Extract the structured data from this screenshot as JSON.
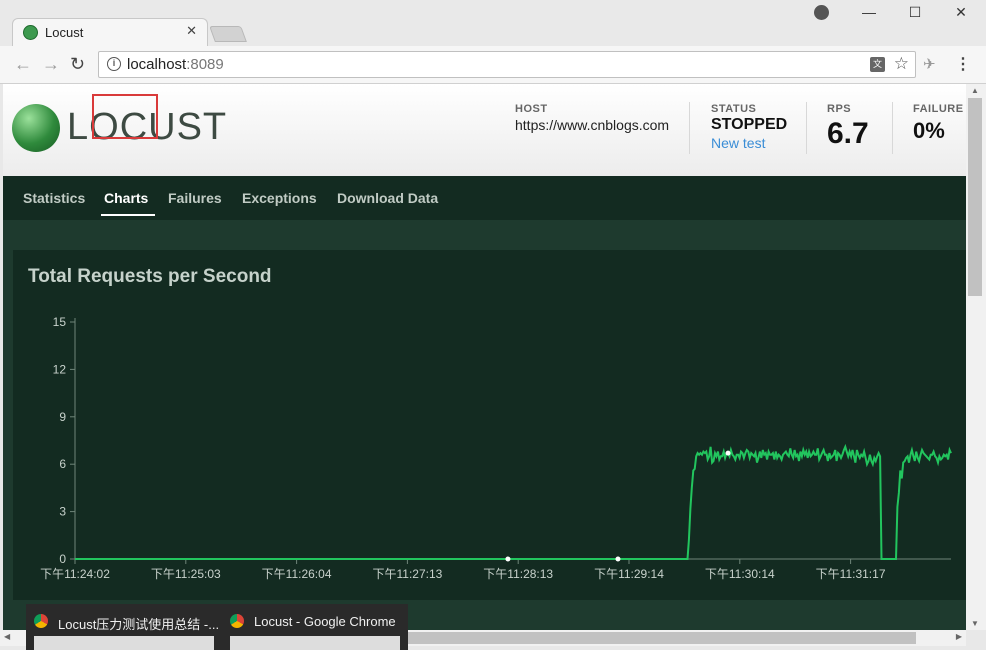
{
  "browser": {
    "tab_title": "Locust",
    "tab_close": "✕",
    "url_host": "localhost",
    "url_port": ":8089",
    "window_controls": [
      "—",
      "☐",
      "✕"
    ]
  },
  "header": {
    "logo_text": "LOCUST",
    "host_label": "HOST",
    "host_value": "https://www.cnblogs.com",
    "status_label": "STATUS",
    "status_value": "STOPPED",
    "new_test_link": "New test",
    "rps_label": "RPS",
    "rps_value": "6.7",
    "failure_label": "FAILURE",
    "failure_value": "0%"
  },
  "nav": {
    "items": [
      "Statistics",
      "Charts",
      "Failures",
      "Exceptions",
      "Download Data"
    ],
    "active": "Charts"
  },
  "panel": {
    "title": "Total Requests per Second"
  },
  "chart_data": {
    "type": "line",
    "title": "Total Requests per Second",
    "xlabel": "",
    "ylabel": "",
    "ylim": [
      0,
      15
    ],
    "y_ticks": [
      0,
      3,
      6,
      9,
      12,
      15
    ],
    "x_tick_labels": [
      "下午11:24:02",
      "下午11:25:03",
      "下午11:26:04",
      "下午11:27:13",
      "下午11:28:13",
      "下午11:29:14",
      "下午11:30:14",
      "下午11:31:17"
    ],
    "line_color": "#22c55e",
    "series": [
      {
        "values": [
          0,
          0,
          0,
          0,
          0,
          0,
          0,
          0,
          0,
          0,
          0,
          0,
          0,
          0,
          0,
          0,
          0,
          0,
          0,
          0,
          0,
          0,
          0,
          0,
          0,
          0,
          0,
          0,
          0,
          0,
          0,
          0,
          0,
          0,
          0,
          0,
          0,
          0,
          0,
          0,
          0,
          0,
          0,
          0,
          0,
          0,
          0,
          0,
          0,
          0,
          0,
          0,
          0,
          0,
          0,
          0,
          0,
          0,
          0,
          0,
          0,
          0,
          0,
          0,
          0,
          0,
          0,
          0,
          0,
          0,
          0,
          0,
          0,
          0,
          0,
          0,
          0,
          0,
          0,
          0,
          0,
          0,
          0,
          0,
          0,
          0,
          0,
          0,
          0,
          0,
          0,
          0,
          0,
          0,
          0,
          0,
          0,
          0,
          0,
          0,
          0,
          0,
          0,
          0,
          0,
          0,
          0,
          0,
          0,
          0,
          0,
          0,
          0,
          0,
          0,
          0,
          0,
          0,
          0,
          0,
          0,
          0,
          0,
          0,
          0,
          0,
          0,
          0,
          0,
          0,
          0,
          0,
          0,
          0,
          0,
          0,
          0,
          0,
          0,
          0,
          0,
          0,
          0,
          0,
          0,
          0,
          0,
          0,
          0,
          0,
          0,
          0,
          0,
          0,
          0,
          0,
          0,
          0,
          0,
          0,
          0,
          0,
          0,
          0,
          0,
          0,
          0,
          0,
          0,
          0,
          0,
          0,
          0,
          0,
          0,
          0,
          0,
          0,
          0,
          0,
          0,
          0,
          0,
          0,
          0,
          0,
          0,
          0,
          0,
          0,
          0,
          0,
          0,
          0,
          0,
          0,
          0,
          0,
          0,
          0,
          0,
          0,
          0,
          0,
          0,
          0,
          0,
          0,
          0,
          0,
          0,
          0,
          0,
          0,
          0,
          0,
          0,
          0,
          0,
          0,
          0,
          0,
          0,
          0,
          0,
          0,
          0,
          0,
          0,
          0,
          0,
          0,
          0,
          0,
          0,
          0,
          0,
          0,
          0,
          0,
          0,
          0,
          0,
          0,
          0,
          0,
          0,
          0,
          0,
          0,
          0,
          0,
          0,
          0,
          0,
          0,
          0,
          0,
          0,
          0,
          0,
          0,
          0,
          0,
          0,
          0,
          0,
          0,
          0,
          0,
          0,
          0,
          0,
          0,
          0,
          0,
          0,
          0,
          0,
          0,
          0,
          0,
          0,
          0,
          0,
          0,
          0,
          0,
          0,
          0,
          0,
          0,
          0,
          0,
          0,
          0,
          0,
          0,
          0,
          0,
          0,
          0,
          0,
          0,
          0,
          0,
          0,
          0,
          0,
          0,
          0,
          0,
          0,
          0,
          0,
          0,
          0,
          0,
          0,
          0,
          0,
          0,
          0,
          0,
          0,
          0,
          0,
          0,
          0,
          0,
          0,
          0,
          0,
          0,
          0,
          0,
          0,
          0,
          0,
          0,
          0,
          0,
          0,
          0,
          0,
          0,
          0,
          0,
          0,
          0,
          0,
          0,
          0,
          0,
          0,
          0,
          0,
          0,
          0,
          0,
          0,
          0,
          0,
          0,
          0,
          0,
          0,
          0,
          0,
          0,
          0,
          0,
          0,
          0,
          0,
          0,
          0,
          0,
          0,
          0,
          0,
          0,
          0,
          0,
          0,
          0,
          0,
          0,
          0,
          0,
          0,
          0,
          0,
          0,
          0,
          0,
          0,
          0,
          0,
          0,
          0,
          0,
          0,
          0,
          0,
          0,
          0,
          0,
          0,
          0,
          0,
          0,
          0,
          0,
          0,
          0,
          0,
          0,
          0,
          0,
          0,
          0,
          0,
          0,
          1.2,
          3.2,
          4.5,
          5.6,
          5.7,
          6.5,
          6.7,
          6.6,
          6.7,
          6.6,
          6.8,
          6.7,
          6.8,
          6.3,
          6.5,
          7.1,
          6.1,
          6.2,
          6.7,
          6.5,
          6.8,
          6.3,
          6.5,
          6.5,
          6.8,
          6.4,
          6.7,
          6.7,
          6.5,
          6.9,
          6.6,
          6.5,
          6.3,
          6.6,
          6.6,
          6.4,
          6.8,
          6.7,
          6.4,
          6.7,
          6.9,
          6.8,
          6.4,
          6.7,
          6.6,
          6.5,
          6.7,
          6.1,
          6.4,
          6.8,
          6.4,
          6.9,
          6.6,
          6.7,
          6.3,
          6.8,
          6.6,
          6.6,
          6.7,
          6.3,
          6.8,
          6.4,
          6.6,
          6.5,
          6.3,
          6.6,
          6.7,
          6.8,
          6.6,
          6.5,
          7.0,
          6.6,
          6.4,
          6.9,
          6.5,
          6.6,
          6.2,
          6.8,
          6.5,
          6.9,
          6.6,
          6.8,
          6.4,
          6.8,
          6.5,
          6.6,
          6.8,
          6.6,
          6.6,
          7.0,
          6.3,
          6.5,
          6.7,
          6.9,
          6.6,
          6.6,
          6.2,
          6.7,
          6.4,
          6.5,
          6.6,
          6.9,
          6.2,
          6.7,
          6.6,
          6.4,
          6.6,
          6.9,
          7.1,
          6.8,
          6.5,
          6.8,
          6.5,
          6.9,
          6.5,
          6.1,
          6.9,
          6.6,
          6.4,
          6.6,
          6.5,
          6.8,
          6.4,
          6.0,
          6.2,
          6.6,
          6.2,
          6.0,
          6.4,
          6.2,
          6.5,
          6.7,
          6.5,
          0,
          0,
          0,
          0,
          0,
          0,
          0,
          0,
          0,
          0,
          0,
          3.3,
          4.2,
          5.6,
          5.1,
          6.1,
          6.2,
          6.4,
          6.5,
          6.1,
          6.6,
          6.9,
          6.5,
          6.2,
          6.8,
          6.4,
          6.2,
          6.6,
          6.9,
          6.7,
          6.6,
          6.5,
          6.4,
          6.3,
          6.6,
          6.6,
          6.8,
          6.5,
          6.4,
          6.1,
          6.5,
          6.3,
          6.4,
          6.6,
          6.5,
          6.6,
          6.3,
          6.9,
          6.7
        ]
      }
    ],
    "markers_at": [
      0.495,
      0.62,
      0.745
    ]
  },
  "taskbar": {
    "previews": [
      "Locust压力测试使用总结 -...",
      "Locust - Google Chrome"
    ]
  }
}
